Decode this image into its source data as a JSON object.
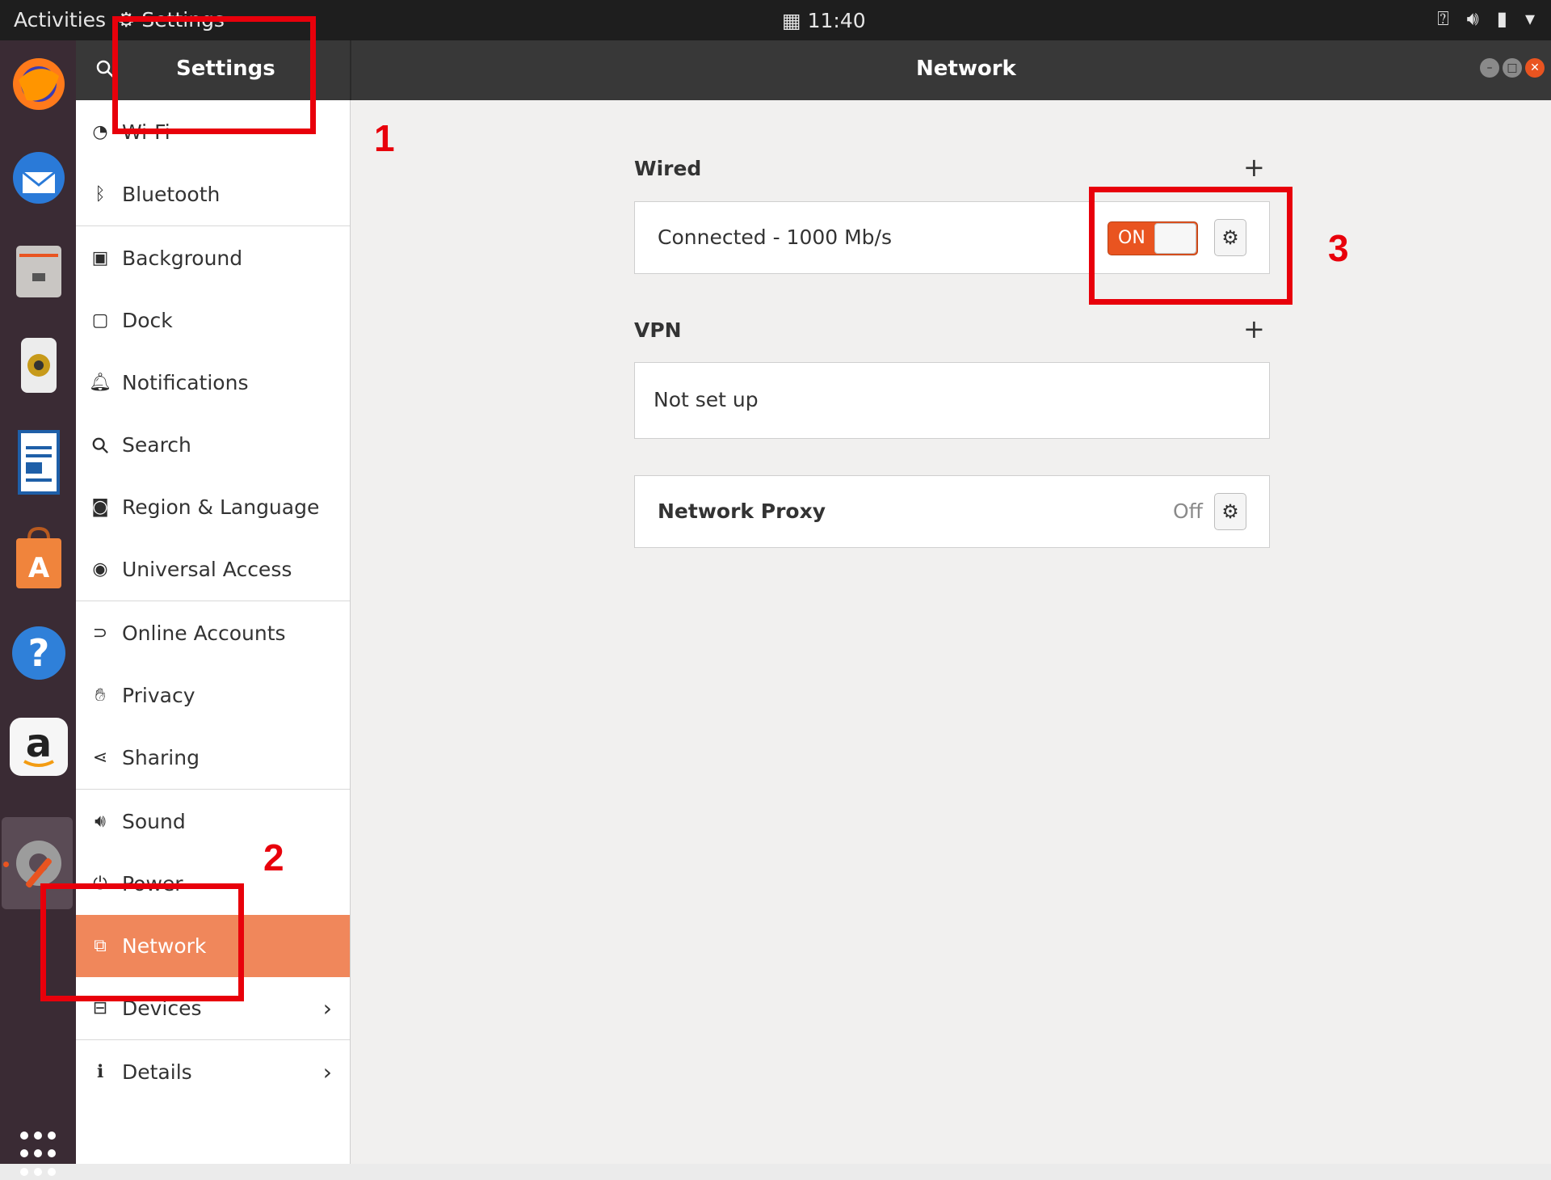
{
  "topbar": {
    "activities": "Activities",
    "app_menu_label": "Settings",
    "clock": "11:40"
  },
  "dock": {
    "items": [
      "firefox",
      "thunderbird",
      "files",
      "rhythmbox",
      "libreoffice-writer",
      "software-center",
      "help",
      "amazon",
      "settings"
    ]
  },
  "titlebar": {
    "left_title": "Settings",
    "main_title": "Network"
  },
  "sidebar": {
    "items": [
      {
        "label": "Wi-Fi"
      },
      {
        "label": "Bluetooth"
      },
      {
        "label": "Background"
      },
      {
        "label": "Dock"
      },
      {
        "label": "Notifications"
      },
      {
        "label": "Search"
      },
      {
        "label": "Region & Language"
      },
      {
        "label": "Universal Access"
      },
      {
        "label": "Online Accounts"
      },
      {
        "label": "Privacy"
      },
      {
        "label": "Sharing"
      },
      {
        "label": "Sound"
      },
      {
        "label": "Power"
      },
      {
        "label": "Network"
      },
      {
        "label": "Devices"
      },
      {
        "label": "Details"
      }
    ],
    "selected": "Network"
  },
  "main": {
    "wired": {
      "title": "Wired",
      "status": "Connected - 1000 Mb/s",
      "toggle_label": "ON"
    },
    "vpn": {
      "title": "VPN",
      "status": "Not set up"
    },
    "proxy": {
      "label": "Network Proxy",
      "state": "Off"
    }
  },
  "annotations": [
    "1",
    "2",
    "3"
  ],
  "colors": {
    "accent": "#e95420",
    "selected_row": "#f0875b",
    "annotation": "#e8000b"
  }
}
